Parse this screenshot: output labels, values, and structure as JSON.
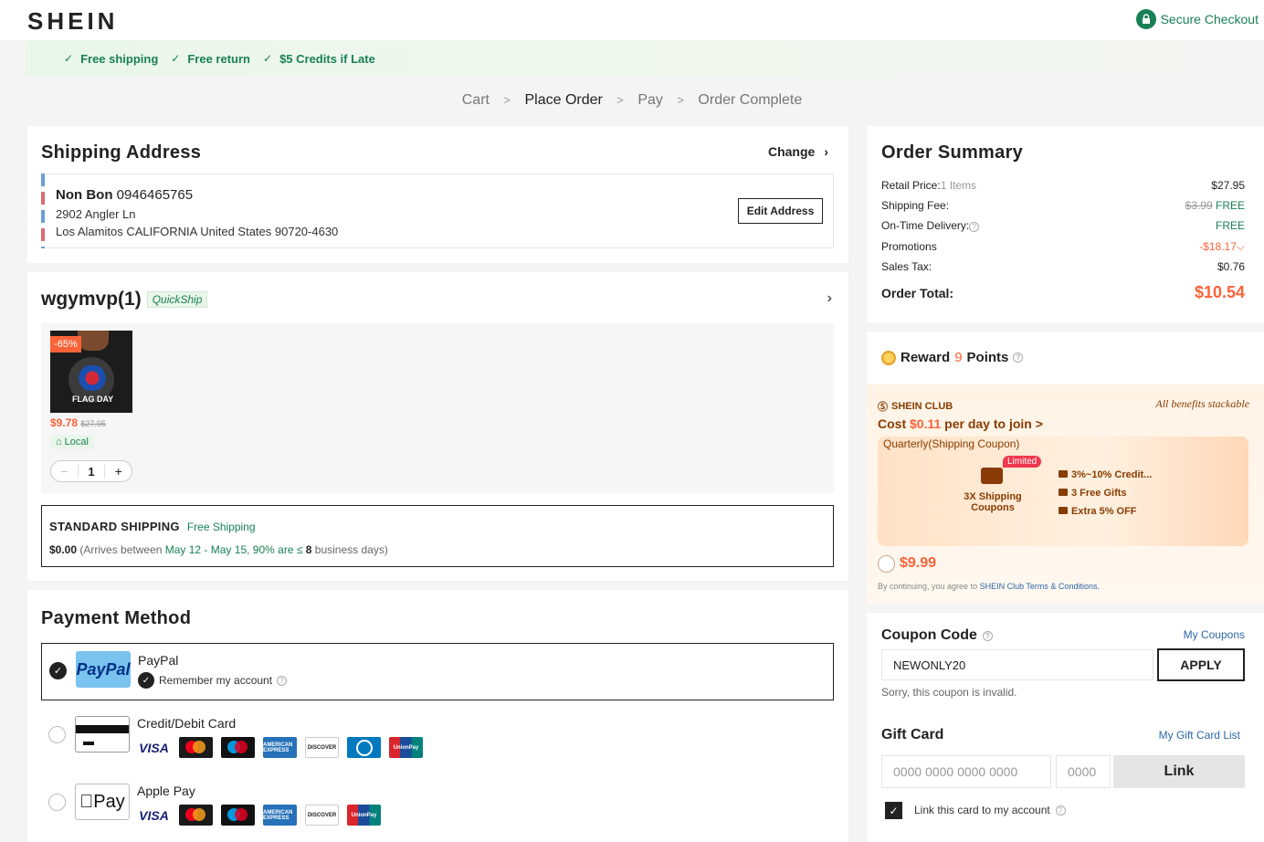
{
  "header": {
    "logo": "SHEIN",
    "secure_checkout": "Secure Checkout",
    "benefits": [
      "Free shipping",
      "Free return",
      "$5 Credits if Late"
    ]
  },
  "steps": [
    "Cart",
    "Place Order",
    "Pay",
    "Order Complete"
  ],
  "shipping_address": {
    "title": "Shipping Address",
    "change": "Change",
    "name": "Non Bon",
    "phone": "0946465765",
    "line1": "2902 Angler Ln",
    "line2": "Los Alamitos CALIFORNIA United States 90720-4630",
    "edit_button": "Edit Address"
  },
  "store": {
    "name": "wgymvp(1)",
    "badge": "QuickShip",
    "item": {
      "discount": "-65%",
      "image_text": "FLAG DAY",
      "price": "$9.78",
      "old_price": "$27.95",
      "local": "Local",
      "qty": "1",
      "minus": "−",
      "plus": "+"
    },
    "shipping": {
      "title": "STANDARD SHIPPING",
      "free_label": "Free Shipping",
      "cost": "$0.00",
      "detail_prefix": "(Arrives between ",
      "dates": "May 12 - May 15",
      "detail_mid": ", ",
      "rate": "90% are ≤",
      "days": "8",
      "detail_suffix": " business days)"
    }
  },
  "payment": {
    "title": "Payment Method",
    "options": [
      {
        "name": "PayPal",
        "logo": "PayPal",
        "remember": "Remember my account"
      },
      {
        "name": "Credit/Debit Card"
      },
      {
        "name": "Apple Pay",
        "logo": "Pay"
      }
    ],
    "brands": {
      "visa": "VISA",
      "amex": "AMERICAN EXPRESS",
      "discover": "DISCOVER",
      "unionpay": "UnionPay"
    }
  },
  "order_summary": {
    "title": "Order Summary",
    "retail_label": "Retail Price:",
    "retail_items": "1 Items",
    "retail_value": "$27.95",
    "shipping_label": "Shipping Fee:",
    "shipping_old": "$3.99",
    "shipping_value": "FREE",
    "ontime_label": "On-Time Delivery:",
    "ontime_value": "FREE",
    "promotions_label": "Promotions",
    "promotions_value": "-$18.17",
    "tax_label": "Sales Tax:",
    "tax_value": "$0.76",
    "total_label": "Order Total:",
    "total_value": "$10.54"
  },
  "reward": {
    "prefix": "Reward",
    "points": "9",
    "suffix": "Points"
  },
  "club": {
    "name": "SHEIN CLUB",
    "stackable": "All benefits stackable",
    "cost_prefix": "Cost ",
    "cost_value": "$0.11",
    "cost_suffix": " per day to join >",
    "card_title": "Quarterly(Shipping Coupon)",
    "limited": "Limited",
    "shipping_coupons": "3X Shipping Coupons",
    "perks": [
      "3%~10% Credit...",
      "3 Free Gifts",
      "Extra 5% OFF"
    ],
    "price": "$9.99",
    "terms_prefix": "By continuing, you agree to ",
    "terms_link": "SHEIN Club Terms & Conditions."
  },
  "coupon": {
    "title": "Coupon Code",
    "my_coupons": "My Coupons",
    "value": "NEWONLY20",
    "apply": "APPLY",
    "error": "Sorry, this coupon is invalid."
  },
  "gift_card": {
    "title": "Gift Card",
    "list_link": "My Gift Card List",
    "card_placeholder": "0000 0000 0000 0000",
    "pin_placeholder": "0000",
    "link_button": "Link",
    "link_label": "Link this card to my account"
  },
  "colors": {
    "accent_green": "#198055",
    "accent_orange": "#fa6338",
    "club_brown": "#873c00"
  }
}
